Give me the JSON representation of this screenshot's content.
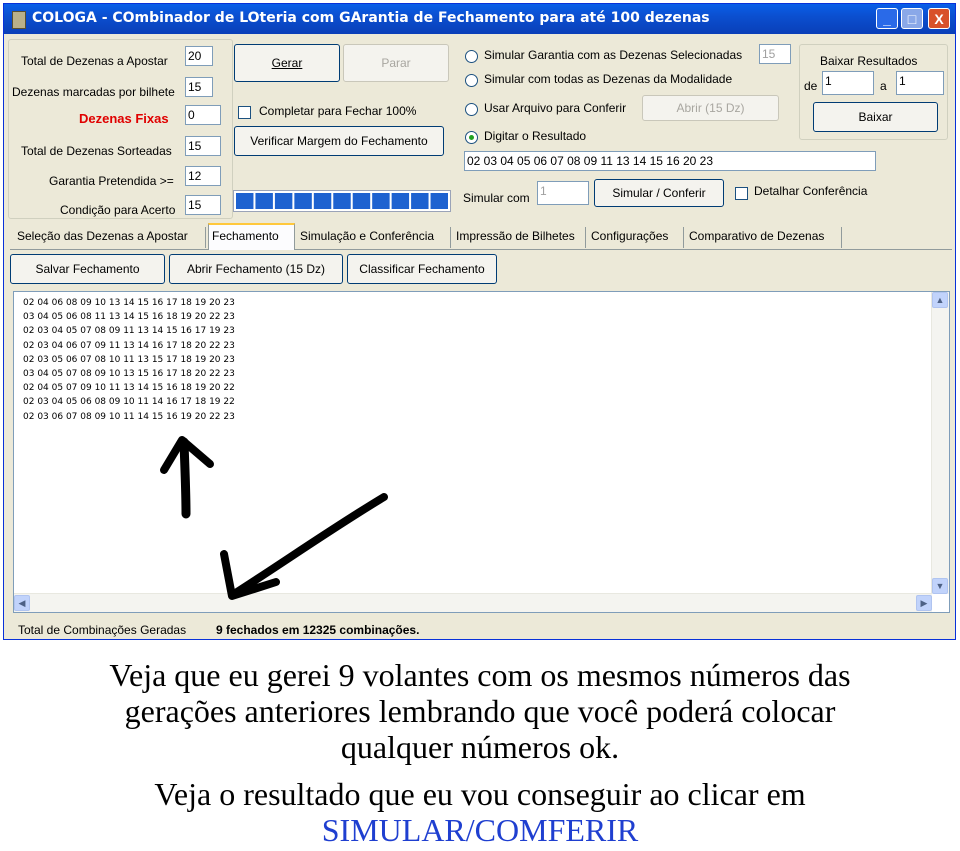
{
  "window": {
    "title": "COLOGA - COmbinador de LOteria com GArantia de Fechamento para até 100 dezenas",
    "controls": {
      "minimize": "_",
      "maximize": "□",
      "close": "X"
    }
  },
  "form": {
    "total_dezenas_apostar": {
      "label": "Total de Dezenas a Apostar",
      "value": "20"
    },
    "dezenas_por_bilhete": {
      "label": "Dezenas marcadas por bilhete",
      "value": "15"
    },
    "dezenas_fixas": {
      "label": "Dezenas Fixas",
      "value": "0",
      "color": "#e00000"
    },
    "total_sorteadas": {
      "label": "Total de Dezenas Sorteadas",
      "value": "15"
    },
    "garantia_pretendida": {
      "label": "Garantia Pretendida >=",
      "value": "12"
    },
    "condicao_acerto": {
      "label": "Condição para Acerto",
      "value": "15"
    }
  },
  "buttons": {
    "gerar": "Gerar",
    "parar": "Parar",
    "completar": "Completar para Fechar 100%",
    "verificar": "Verificar Margem do Fechamento"
  },
  "progress": {
    "segments": 11,
    "fill_fraction": 1.0,
    "color": "#1e62d0"
  },
  "simulation": {
    "radio_garantia": {
      "label": "Simular Garantia com as Dezenas Selecionadas",
      "value": "15",
      "selected": false
    },
    "radio_todas": {
      "label": "Simular com todas as Dezenas da Modalidade",
      "selected": false
    },
    "radio_arquivo": {
      "label": "Usar Arquivo para Conferir",
      "button": "Abrir (15 Dz)",
      "selected": false
    },
    "radio_digitar": {
      "label": "Digitar o Resultado",
      "selected": true
    },
    "resultado": "02 03 04 05 06 07 08 09 11 13 14 15 16 20 23",
    "simular_com_label": "Simular com",
    "simular_com_value": "1",
    "simular_button": "Simular / Conferir",
    "detalhar_label": "Detalhar Conferência"
  },
  "baixar": {
    "title": "Baixar Resultados",
    "de_label": "de",
    "de_value": "1",
    "a_label": "a",
    "a_value": "1",
    "button": "Baixar"
  },
  "tabs": [
    {
      "label": "Seleção das Dezenas a Apostar"
    },
    {
      "label": "Fechamento"
    },
    {
      "label": "Simulação e Conferência"
    },
    {
      "label": "Impressão de Bilhetes"
    },
    {
      "label": "Configurações"
    },
    {
      "label": "Comparativo de Dezenas"
    }
  ],
  "fechamento": {
    "salvar": "Salvar Fechamento",
    "abrir": "Abrir Fechamento (15 Dz)",
    "classificar": "Classificar Fechamento",
    "combinations": [
      "02 04 06 08 09 10 13 14 15 16 17 18 19 20 23",
      "03 04 05 06 08 11 13 14 15 16 18 19 20 22 23",
      "02 03 04 05 07 08 09 11 13 14 15 16 17 19 23",
      "02 03 04 06 07 09 11 13 14 16 17 18 20 22 23",
      "02 03 05 06 07 08 10 11 13 15 17 18 19 20 23",
      "03 04 05 07 08 09 10 13 15 16 17 18 20 22 23",
      "02 04 05 07 09 10 11 13 14 15 16 18 19 20 22",
      "02 03 04 05 06 08 09 10 11 14 16 17 18 19 22",
      "02 03 06 07 08 09 10 11 14 15 16 19 20 22 23"
    ]
  },
  "status": {
    "label": "Total de Combinações Geradas",
    "value": "9 fechados em 12325 combinações."
  },
  "caption": {
    "line1": "Veja que eu gerei 9 volantes com os mesmos números das",
    "line2": "gerações anteriores lembrando que você poderá colocar",
    "line3": "qualquer números ok.",
    "line4": "Veja o resultado que eu vou conseguir ao clicar em",
    "line5": "SIMULAR/COMFERIR",
    "line5_color": "#1f3fd0"
  }
}
